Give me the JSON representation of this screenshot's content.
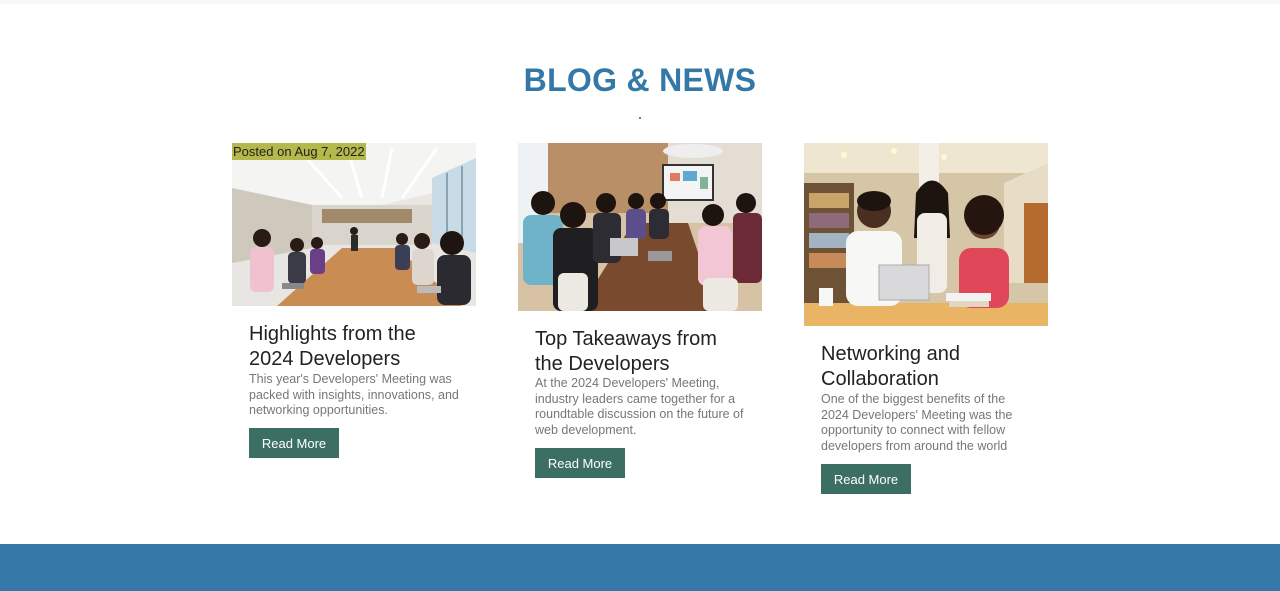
{
  "section": {
    "title": "BLOG & NEWS"
  },
  "cards": [
    {
      "posted": "Posted on Aug 7, 2022",
      "title": "Highlights from the 2024 Developers",
      "text": "This year's Developers' Meeting was packed with insights, innovations, and networking opportunities.",
      "button": "Read More",
      "image": "conference-room-meeting-image"
    },
    {
      "title": "Top Takeaways from the Developers",
      "text": "At the 2024 Developers' Meeting, industry leaders came together for a roundtable discussion on the future of web development.",
      "button": "Read More",
      "image": "roundtable-discussion-image"
    },
    {
      "title": "Networking and Collaboration",
      "text": "One of the biggest benefits of the 2024 Developers' Meeting was the opportunity to connect with fellow developers from around the world",
      "button": "Read More",
      "image": "library-collaboration-image"
    }
  ],
  "colors": {
    "heading": "#3478a8",
    "button": "#3c6f63",
    "badge": "#b5b84a",
    "footer": "#3478a8"
  }
}
